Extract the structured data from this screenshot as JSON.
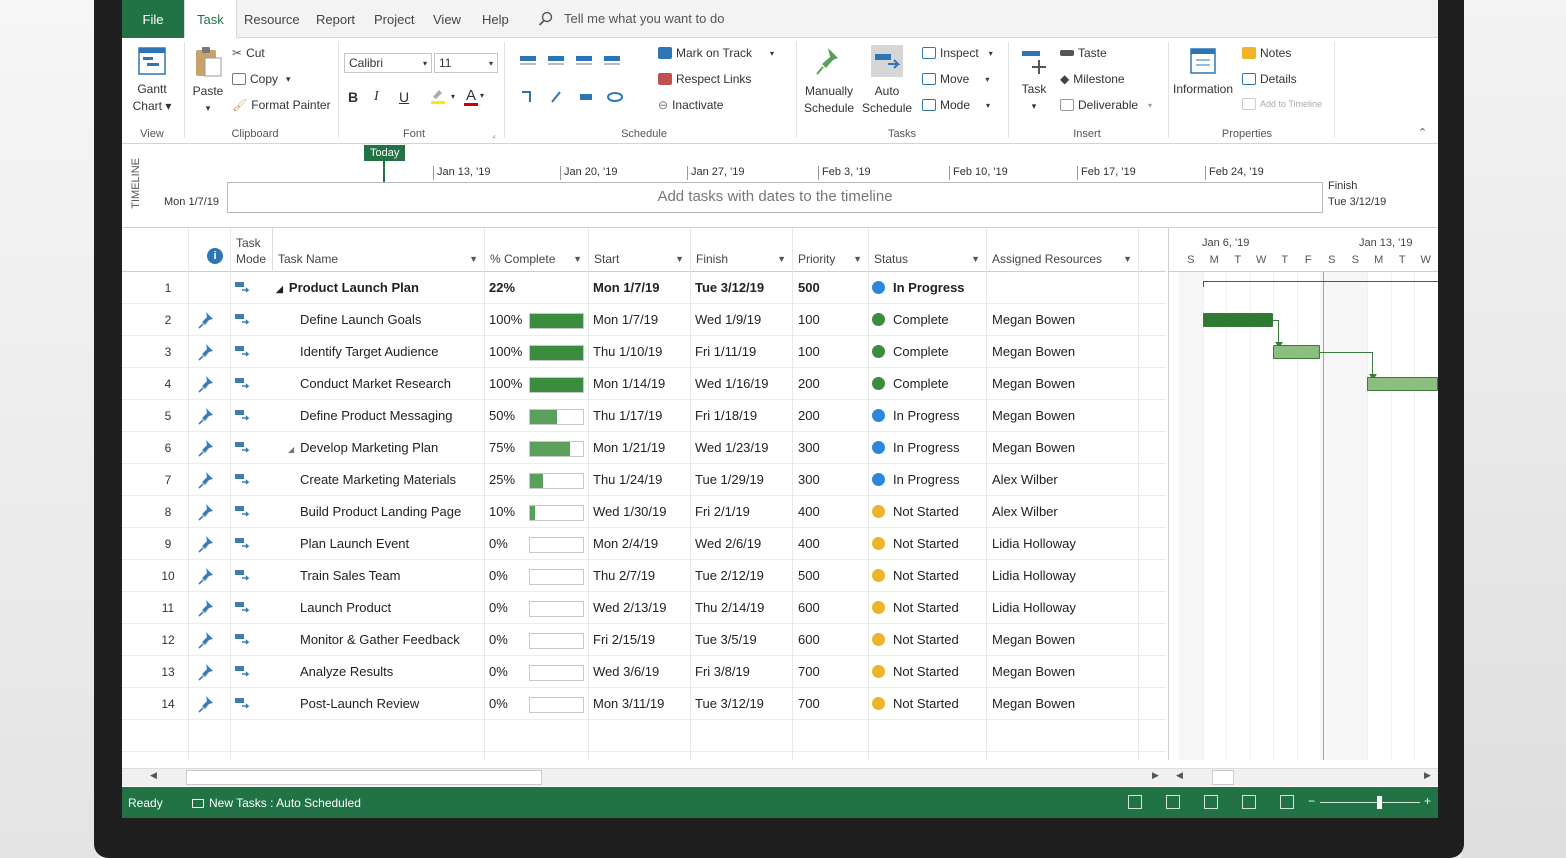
{
  "ribbon_tabs": [
    "File",
    "Task",
    "Resource",
    "Report",
    "Project",
    "View",
    "Help"
  ],
  "tell_me": "Tell me what you want to do",
  "ribbon": {
    "gantt_chart": "Gantt",
    "gantt_chart2": "Chart",
    "view_group": "View",
    "paste": "Paste",
    "cut": "Cut",
    "copy": "Copy",
    "format_painter": "Format Painter",
    "clipboard_group": "Clipboard",
    "font_name": "Calibri",
    "font_size": "11",
    "bold": "B",
    "italic": "I",
    "underline": "U",
    "font_color": "A",
    "font_group": "Font",
    "mark_on_track": "Mark on Track",
    "respect_links": "Respect Links",
    "inactivate": "Inactivate",
    "schedule_group": "Schedule",
    "manually": "Manually",
    "schedule1": "Schedule",
    "auto": "Auto",
    "schedule2": "Schedule",
    "inspect": "Inspect",
    "move": "Move",
    "mode": "Mode",
    "tasks_group": "Tasks",
    "task": "Task",
    "taste": "Taste",
    "milestone": "Milestone",
    "deliverable": "Deliverable",
    "insert_group": "Insert",
    "information": "Information",
    "notes": "Notes",
    "details": "Details",
    "add_to_timeline": "Add to Timeline",
    "properties_group": "Properties"
  },
  "timeline": {
    "label": "TIMELINE",
    "today": "Today",
    "start": "Mon 1/7/19",
    "finish_label": "Finish",
    "finish": "Tue 3/12/19",
    "hint": "Add tasks with dates to the timeline",
    "ticks": [
      "Jan 13, '19",
      "Jan 20, '19",
      "Jan 27, '19",
      "Feb 3, '19",
      "Feb 10, '19",
      "Feb 17, '19",
      "Feb 24, '19"
    ]
  },
  "columns": {
    "mode1": "Task",
    "mode2": "Mode",
    "name": "Task Name",
    "complete": "% Complete",
    "start": "Start",
    "finish": "Finish",
    "priority": "Priority",
    "status": "Status",
    "resources": "Assigned Resources"
  },
  "tasks": [
    {
      "id": "1",
      "name": "Product Launch Plan",
      "pct": "22%",
      "pctv": 22,
      "start": "Mon 1/7/19",
      "finish": "Tue 3/12/19",
      "priority": "500",
      "status": "In Progress",
      "res": "",
      "summary": true
    },
    {
      "id": "2",
      "name": "Define Launch Goals",
      "pct": "100%",
      "pctv": 100,
      "start": "Mon 1/7/19",
      "finish": "Wed 1/9/19",
      "priority": "100",
      "status": "Complete",
      "res": "Megan Bowen"
    },
    {
      "id": "3",
      "name": "Identify Target Audience",
      "pct": "100%",
      "pctv": 100,
      "start": "Thu 1/10/19",
      "finish": "Fri 1/11/19",
      "priority": "100",
      "status": "Complete",
      "res": "Megan Bowen"
    },
    {
      "id": "4",
      "name": "Conduct Market Research",
      "pct": "100%",
      "pctv": 100,
      "start": "Mon 1/14/19",
      "finish": "Wed 1/16/19",
      "priority": "200",
      "status": "Complete",
      "res": "Megan Bowen"
    },
    {
      "id": "5",
      "name": "Define Product Messaging",
      "pct": "50%",
      "pctv": 50,
      "start": "Thu 1/17/19",
      "finish": "Fri 1/18/19",
      "priority": "200",
      "status": "In Progress",
      "res": "Megan Bowen"
    },
    {
      "id": "6",
      "name": "Develop Marketing Plan",
      "pct": "75%",
      "pctv": 75,
      "start": "Mon 1/21/19",
      "finish": "Wed 1/23/19",
      "priority": "300",
      "status": "In Progress",
      "res": "Megan Bowen",
      "sub": true
    },
    {
      "id": "7",
      "name": "Create Marketing Materials",
      "pct": "25%",
      "pctv": 25,
      "start": "Thu 1/24/19",
      "finish": "Tue 1/29/19",
      "priority": "300",
      "status": "In Progress",
      "res": "Alex Wilber"
    },
    {
      "id": "8",
      "name": "Build Product Landing Page",
      "pct": "10%",
      "pctv": 10,
      "start": "Wed 1/30/19",
      "finish": "Fri 2/1/19",
      "priority": "400",
      "status": "Not Started",
      "res": "Alex Wilber"
    },
    {
      "id": "9",
      "name": "Plan Launch Event",
      "pct": "0%",
      "pctv": 0,
      "start": "Mon 2/4/19",
      "finish": "Wed 2/6/19",
      "priority": "400",
      "status": "Not Started",
      "res": "Lidia Holloway"
    },
    {
      "id": "10",
      "name": "Train Sales Team",
      "pct": "0%",
      "pctv": 0,
      "start": "Thu 2/7/19",
      "finish": "Tue 2/12/19",
      "priority": "500",
      "status": "Not Started",
      "res": "Lidia Holloway"
    },
    {
      "id": "11",
      "name": "Launch Product",
      "pct": "0%",
      "pctv": 0,
      "start": "Wed 2/13/19",
      "finish": "Thu 2/14/19",
      "priority": "600",
      "status": "Not Started",
      "res": "Lidia Holloway"
    },
    {
      "id": "12",
      "name": "Monitor & Gather Feedback",
      "pct": "0%",
      "pctv": 0,
      "start": "Fri 2/15/19",
      "finish": "Tue 3/5/19",
      "priority": "600",
      "status": "Not Started",
      "res": "Megan Bowen"
    },
    {
      "id": "13",
      "name": "Analyze Results",
      "pct": "0%",
      "pctv": 0,
      "start": "Wed 3/6/19",
      "finish": "Fri 3/8/19",
      "priority": "700",
      "status": "Not Started",
      "res": "Megan Bowen"
    },
    {
      "id": "14",
      "name": "Post-Launch Review",
      "pct": "0%",
      "pctv": 0,
      "start": "Mon 3/11/19",
      "finish": "Tue 3/12/19",
      "priority": "700",
      "status": "Not Started",
      "res": "Megan Bowen"
    }
  ],
  "status_colors": {
    "Complete": "#3a8c3f",
    "In Progress": "#2b88d8",
    "Not Started": "#f0b429"
  },
  "gantt": {
    "week1": "Jan 6, '19",
    "week2": "Jan 13, '19",
    "days": [
      "S",
      "M",
      "T",
      "W",
      "T",
      "F",
      "S",
      "S",
      "M",
      "T",
      "W"
    ]
  },
  "statusbar": {
    "ready": "Ready",
    "new_tasks": "New Tasks : Auto Scheduled"
  }
}
